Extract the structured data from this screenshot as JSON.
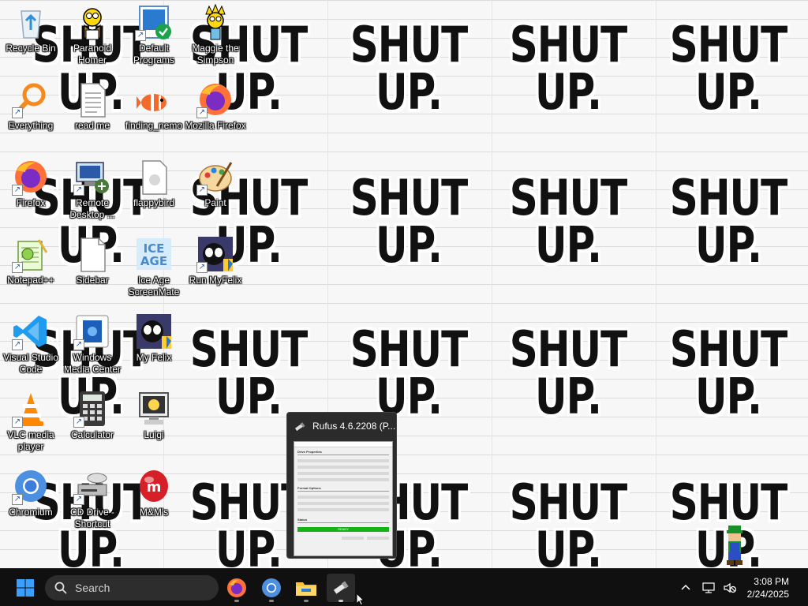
{
  "wallpaper": {
    "line1": "SHUT",
    "line2": "UP."
  },
  "desktop_icons": [
    {
      "label": "Recycle Bin",
      "icon": "recycle-bin-icon"
    },
    {
      "label": "Paranoid Homer",
      "icon": "homer-icon"
    },
    {
      "label": "Default Programs",
      "icon": "default-programs-icon"
    },
    {
      "label": "Maggie the Simpson",
      "icon": "maggie-icon"
    },
    {
      "label": "Everything",
      "icon": "everything-search-icon"
    },
    {
      "label": "read me",
      "icon": "text-file-icon"
    },
    {
      "label": "finding_nemo",
      "icon": "nemo-icon"
    },
    {
      "label": "Mozilla Firefox",
      "icon": "firefox-icon"
    },
    {
      "label": "Firefox",
      "icon": "firefox-icon"
    },
    {
      "label": "Remote Desktop ...",
      "icon": "remote-desktop-icon"
    },
    {
      "label": "flappybird",
      "icon": "file-icon"
    },
    {
      "label": "Paint",
      "icon": "paint-icon"
    },
    {
      "label": "Notepad++",
      "icon": "notepadpp-icon"
    },
    {
      "label": "Sidebar",
      "icon": "blank-file-icon"
    },
    {
      "label": "Ice Age ScreenMate",
      "icon": "ice-age-icon"
    },
    {
      "label": "Run MyFelix",
      "icon": "felix-icon"
    },
    {
      "label": "Visual Studio Code",
      "icon": "vscode-icon"
    },
    {
      "label": "Windows Media Center",
      "icon": "media-center-icon"
    },
    {
      "label": "My Felix",
      "icon": "felix-icon"
    },
    {
      "label": "VLC media player",
      "icon": "vlc-icon"
    },
    {
      "label": "Calculator",
      "icon": "calculator-icon"
    },
    {
      "label": "Luigi",
      "icon": "luigi-icon"
    },
    {
      "label": "Chromium",
      "icon": "chromium-icon"
    },
    {
      "label": "CD Drive - Shortcut",
      "icon": "cd-drive-icon"
    },
    {
      "label": "M&M's",
      "icon": "mm-icon"
    }
  ],
  "rufus_preview": {
    "title": "Rufus 4.6.2208 (P...",
    "drive_properties": "Drive Properties",
    "format_options": "Format Options",
    "status": "Status",
    "ready": "READY"
  },
  "taskbar": {
    "search_placeholder": "Search",
    "time": "3:08 PM",
    "date": "2/24/2025",
    "pinned": [
      "firefox-icon",
      "chromium-icon",
      "file-explorer-icon",
      "rufus-icon"
    ]
  },
  "colors": {
    "taskbar_bg": "#101010",
    "start_blue": "#3aa0ff",
    "ready_green": "#16b316"
  }
}
